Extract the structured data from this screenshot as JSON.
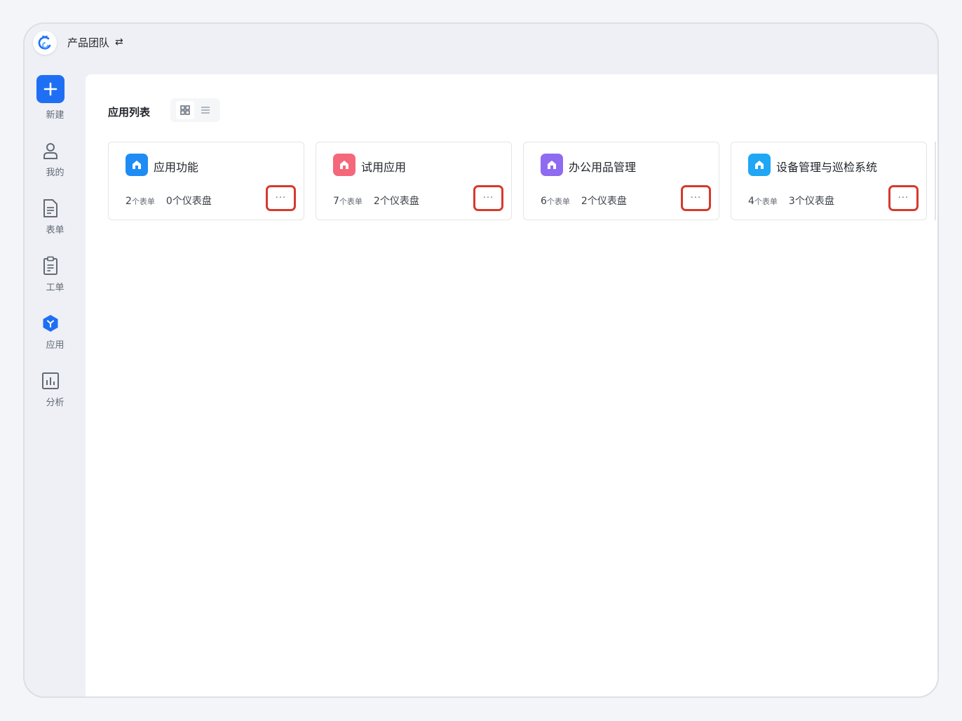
{
  "header": {
    "team_name": "产品团队",
    "switch_icon": "swap-icon",
    "switch_glyph": "⇄"
  },
  "sidebar": {
    "items": [
      {
        "label": "新建",
        "icon": "plus-icon"
      },
      {
        "label": "我的",
        "icon": "user-icon"
      },
      {
        "label": "表单",
        "icon": "document-icon"
      },
      {
        "label": "工单",
        "icon": "clipboard-icon"
      },
      {
        "label": "应用",
        "icon": "app-hexagon-icon"
      },
      {
        "label": "分析",
        "icon": "bar-chart-icon"
      }
    ]
  },
  "main": {
    "title": "应用列表",
    "view_modes": [
      "grid",
      "list"
    ],
    "active_view": "grid",
    "more_label": "···",
    "apps": [
      {
        "name": "应用功能",
        "forms_count": "2",
        "forms_unit": "个表单",
        "dashboards": "0个仪表盘",
        "icon_color": "#1f8cf5"
      },
      {
        "name": "试用应用",
        "forms_count": "7",
        "forms_unit": "个表单",
        "dashboards": "2个仪表盘",
        "icon_color": "#f5677a"
      },
      {
        "name": "办公用品管理",
        "forms_count": "6",
        "forms_unit": "个表单",
        "dashboards": "2个仪表盘",
        "icon_color": "#8e6bf0"
      },
      {
        "name": "设备管理与巡检系统",
        "forms_count": "4",
        "forms_unit": "个表单",
        "dashboards": "3个仪表盘",
        "icon_color": "#1fa6f5"
      }
    ]
  },
  "colors": {
    "accent": "#1f6ff5",
    "highlight_border": "#d63a2c"
  }
}
